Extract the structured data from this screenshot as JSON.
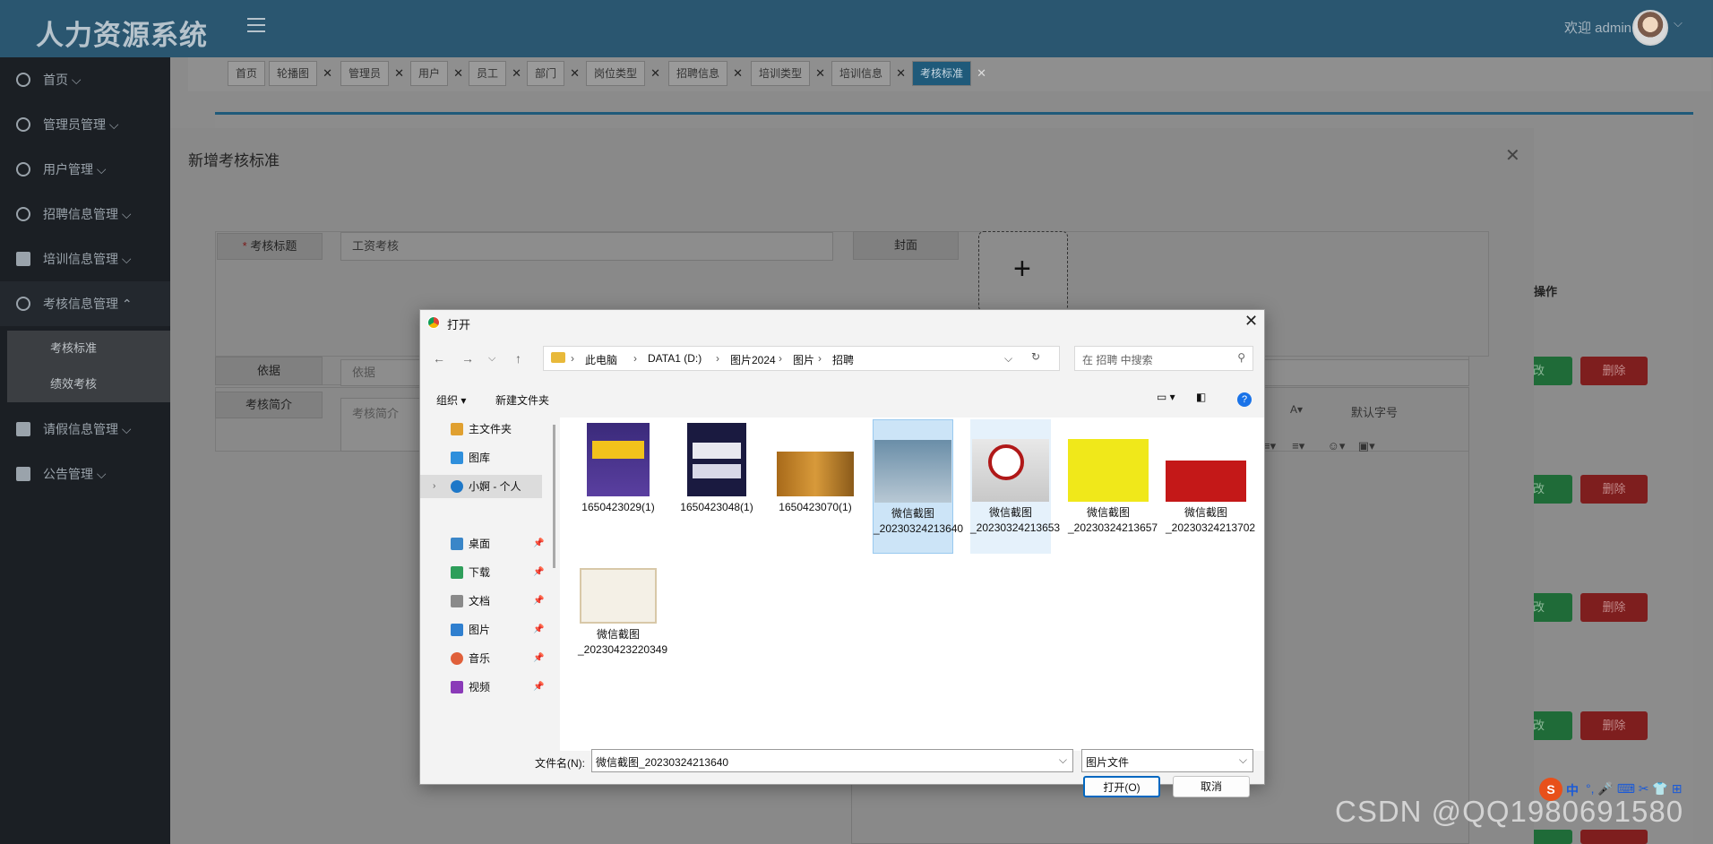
{
  "app": {
    "title": "人力资源系统",
    "welcome": "欢迎 admin"
  },
  "sidebar": {
    "items": [
      {
        "label": "首页"
      },
      {
        "label": "管理员管理"
      },
      {
        "label": "用户管理"
      },
      {
        "label": "招聘信息管理"
      },
      {
        "label": "培训信息管理"
      },
      {
        "label": "考核信息管理"
      },
      {
        "label": "请假信息管理"
      },
      {
        "label": "公告管理"
      }
    ],
    "subitems": [
      {
        "label": "考核标准"
      },
      {
        "label": "绩效考核"
      }
    ]
  },
  "tabs": [
    "首页",
    "轮播图",
    "管理员",
    "用户",
    "员工",
    "部门",
    "岗位类型",
    "招聘信息",
    "培训类型",
    "培训信息",
    "考核标准"
  ],
  "background": {
    "op_header": "操作",
    "edit_label": "改",
    "delete_label": "删除"
  },
  "modal": {
    "title": "新增考核标准",
    "fields": {
      "title_label": "考核标题",
      "title_value": "工资考核",
      "cover_label": "封面",
      "basis_label": "依据",
      "basis_placeholder": "依据",
      "intro_label": "考核简介",
      "intro_placeholder": "考核简介",
      "editor_fontsize": "默认字号"
    }
  },
  "dialog": {
    "title": "打开",
    "breadcrumb": [
      "此电脑",
      "DATA1 (D:)",
      "图片2024",
      "图片",
      "招聘"
    ],
    "search_placeholder": "在 招聘 中搜索",
    "organize": "组织",
    "new_folder": "新建文件夹",
    "nav": [
      "主文件夹",
      "图库",
      "小婀 - 个人",
      "桌面",
      "下载",
      "文档",
      "图片",
      "音乐",
      "视频"
    ],
    "files": [
      {
        "name": "1650423029(1)"
      },
      {
        "name": "1650423048(1)"
      },
      {
        "name": "1650423070(1)"
      },
      {
        "name": "微信截图_20230324213640"
      },
      {
        "name": "微信截图_20230324213653"
      },
      {
        "name": "微信截图_20230324213657"
      },
      {
        "name": "微信截图_20230324213702"
      },
      {
        "name": "微信截图_20230423220349"
      }
    ],
    "filename_label": "文件名(N):",
    "filename_value": "微信截图_20230324213640",
    "filetype": "图片文件",
    "open_button": "打开(O)",
    "cancel_button": "取消"
  },
  "watermark": "CSDN @QQ1980691580",
  "ime": {
    "lang": "中"
  }
}
